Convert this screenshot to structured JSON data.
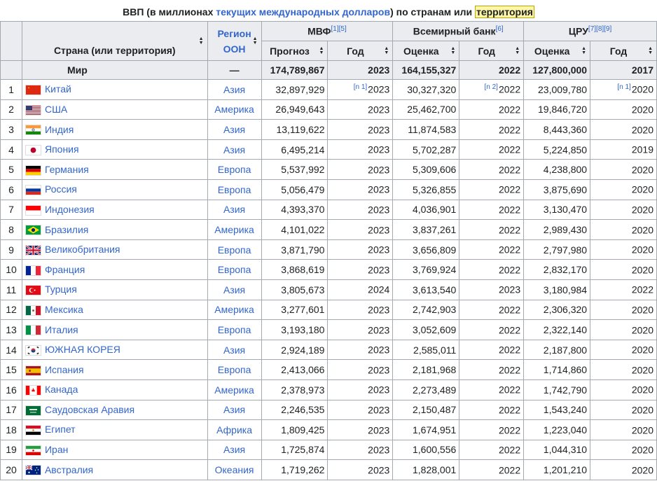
{
  "caption": {
    "pre": "ВВП (в миллионах ",
    "link": "текущих международных долларов",
    "mid": ") по странам или ",
    "highlight": "территория"
  },
  "headers": {
    "country": "Страна (или территория)",
    "region_line1": "Регион",
    "region_line2": "ООН",
    "imf": "МВФ",
    "imf_refs": "[1][5]",
    "wb": "Всемирный банк",
    "wb_refs": "[6]",
    "cia": "ЦРУ",
    "cia_refs": "[7][8][9]",
    "forecast": "Прогноз",
    "year": "Год",
    "estimate": "Оценка"
  },
  "world": {
    "name": "Мир",
    "region": "—",
    "imf": "174,789,867",
    "imf_year": "2023",
    "wb": "164,155,327",
    "wb_year": "2022",
    "cia": "127,800,000",
    "cia_year": "2017"
  },
  "rows": [
    {
      "rank": "1",
      "name": "Китай",
      "region": "Азия",
      "imf": "32,897,929",
      "imf_note": "[n 1]",
      "imf_year": "2023",
      "wb": "30,327,320",
      "wb_note": "[n 2]",
      "wb_year": "2022",
      "cia": "23,009,780",
      "cia_note": "[n 1]",
      "cia_year": "2020"
    },
    {
      "rank": "2",
      "name": "США",
      "region": "Америка",
      "imf": "26,949,643",
      "imf_note": "",
      "imf_year": "2023",
      "wb": "25,462,700",
      "wb_note": "",
      "wb_year": "2022",
      "cia": "19,846,720",
      "cia_note": "",
      "cia_year": "2020"
    },
    {
      "rank": "3",
      "name": "Индия",
      "region": "Азия",
      "imf": "13,119,622",
      "imf_note": "",
      "imf_year": "2023",
      "wb": "11,874,583",
      "wb_note": "",
      "wb_year": "2022",
      "cia": "8,443,360",
      "cia_note": "",
      "cia_year": "2020"
    },
    {
      "rank": "4",
      "name": "Япония",
      "region": "Азия",
      "imf": "6,495,214",
      "imf_note": "",
      "imf_year": "2023",
      "wb": "5,702,287",
      "wb_note": "",
      "wb_year": "2022",
      "cia": "5,224,850",
      "cia_note": "",
      "cia_year": "2019"
    },
    {
      "rank": "5",
      "name": "Германия",
      "region": "Европа",
      "imf": "5,537,992",
      "imf_note": "",
      "imf_year": "2023",
      "wb": "5,309,606",
      "wb_note": "",
      "wb_year": "2022",
      "cia": "4,238,800",
      "cia_note": "",
      "cia_year": "2020"
    },
    {
      "rank": "6",
      "name": "Россия",
      "region": "Европа",
      "imf": "5,056,479",
      "imf_note": "",
      "imf_year": "2023",
      "wb": "5,326,855",
      "wb_note": "",
      "wb_year": "2022",
      "cia": "3,875,690",
      "cia_note": "",
      "cia_year": "2020"
    },
    {
      "rank": "7",
      "name": "Индонезия",
      "region": "Азия",
      "imf": "4,393,370",
      "imf_note": "",
      "imf_year": "2023",
      "wb": "4,036,901",
      "wb_note": "",
      "wb_year": "2022",
      "cia": "3,130,470",
      "cia_note": "",
      "cia_year": "2020"
    },
    {
      "rank": "8",
      "name": "Бразилия",
      "region": "Америка",
      "imf": "4,101,022",
      "imf_note": "",
      "imf_year": "2023",
      "wb": "3,837,261",
      "wb_note": "",
      "wb_year": "2022",
      "cia": "2,989,430",
      "cia_note": "",
      "cia_year": "2020"
    },
    {
      "rank": "9",
      "name": "Великобритания",
      "region": "Европа",
      "imf": "3,871,790",
      "imf_note": "",
      "imf_year": "2023",
      "wb": "3,656,809",
      "wb_note": "",
      "wb_year": "2022",
      "cia": "2,797,980",
      "cia_note": "",
      "cia_year": "2020"
    },
    {
      "rank": "10",
      "name": "Франция",
      "region": "Европа",
      "imf": "3,868,619",
      "imf_note": "",
      "imf_year": "2023",
      "wb": "3,769,924",
      "wb_note": "",
      "wb_year": "2022",
      "cia": "2,832,170",
      "cia_note": "",
      "cia_year": "2020"
    },
    {
      "rank": "11",
      "name": "Турция",
      "region": "Азия",
      "imf": "3,805,673",
      "imf_note": "",
      "imf_year": "2024",
      "wb": "3,613,540",
      "wb_note": "",
      "wb_year": "2023",
      "cia": "3,180,984",
      "cia_note": "",
      "cia_year": "2022"
    },
    {
      "rank": "12",
      "name": "Мексика",
      "region": "Америка",
      "imf": "3,277,601",
      "imf_note": "",
      "imf_year": "2023",
      "wb": "2,742,903",
      "wb_note": "",
      "wb_year": "2022",
      "cia": "2,306,320",
      "cia_note": "",
      "cia_year": "2020"
    },
    {
      "rank": "13",
      "name": "Италия",
      "region": "Европа",
      "imf": "3,193,180",
      "imf_note": "",
      "imf_year": "2023",
      "wb": "3,052,609",
      "wb_note": "",
      "wb_year": "2022",
      "cia": "2,322,140",
      "cia_note": "",
      "cia_year": "2020"
    },
    {
      "rank": "14",
      "name": "ЮЖНАЯ КОРЕЯ",
      "region": "Азия",
      "imf": "2,924,189",
      "imf_note": "",
      "imf_year": "2023",
      "wb": "2,585,011",
      "wb_note": "",
      "wb_year": "2022",
      "cia": "2,187,800",
      "cia_note": "",
      "cia_year": "2020"
    },
    {
      "rank": "15",
      "name": "Испания",
      "region": "Европа",
      "imf": "2,413,066",
      "imf_note": "",
      "imf_year": "2023",
      "wb": "2,181,968",
      "wb_note": "",
      "wb_year": "2022",
      "cia": "1,714,860",
      "cia_note": "",
      "cia_year": "2020"
    },
    {
      "rank": "16",
      "name": "Канада",
      "region": "Америка",
      "imf": "2,378,973",
      "imf_note": "",
      "imf_year": "2023",
      "wb": "2,273,489",
      "wb_note": "",
      "wb_year": "2022",
      "cia": "1,742,790",
      "cia_note": "",
      "cia_year": "2020"
    },
    {
      "rank": "17",
      "name": "Саудовская Аравия",
      "region": "Азия",
      "imf": "2,246,535",
      "imf_note": "",
      "imf_year": "2023",
      "wb": "2,150,487",
      "wb_note": "",
      "wb_year": "2022",
      "cia": "1,543,240",
      "cia_note": "",
      "cia_year": "2020"
    },
    {
      "rank": "18",
      "name": "Египет",
      "region": "Африка",
      "imf": "1,809,425",
      "imf_note": "",
      "imf_year": "2023",
      "wb": "1,674,951",
      "wb_note": "",
      "wb_year": "2022",
      "cia": "1,223,040",
      "cia_note": "",
      "cia_year": "2020"
    },
    {
      "rank": "19",
      "name": "Иран",
      "region": "Азия",
      "imf": "1,725,874",
      "imf_note": "",
      "imf_year": "2023",
      "wb": "1,600,556",
      "wb_note": "",
      "wb_year": "2022",
      "cia": "1,044,310",
      "cia_note": "",
      "cia_year": "2020"
    },
    {
      "rank": "20",
      "name": "Австралия",
      "region": "Океания",
      "imf": "1,719,262",
      "imf_note": "",
      "imf_year": "2023",
      "wb": "1,828,001",
      "wb_note": "",
      "wb_year": "2022",
      "cia": "1,201,210",
      "cia_note": "",
      "cia_year": "2020"
    }
  ]
}
